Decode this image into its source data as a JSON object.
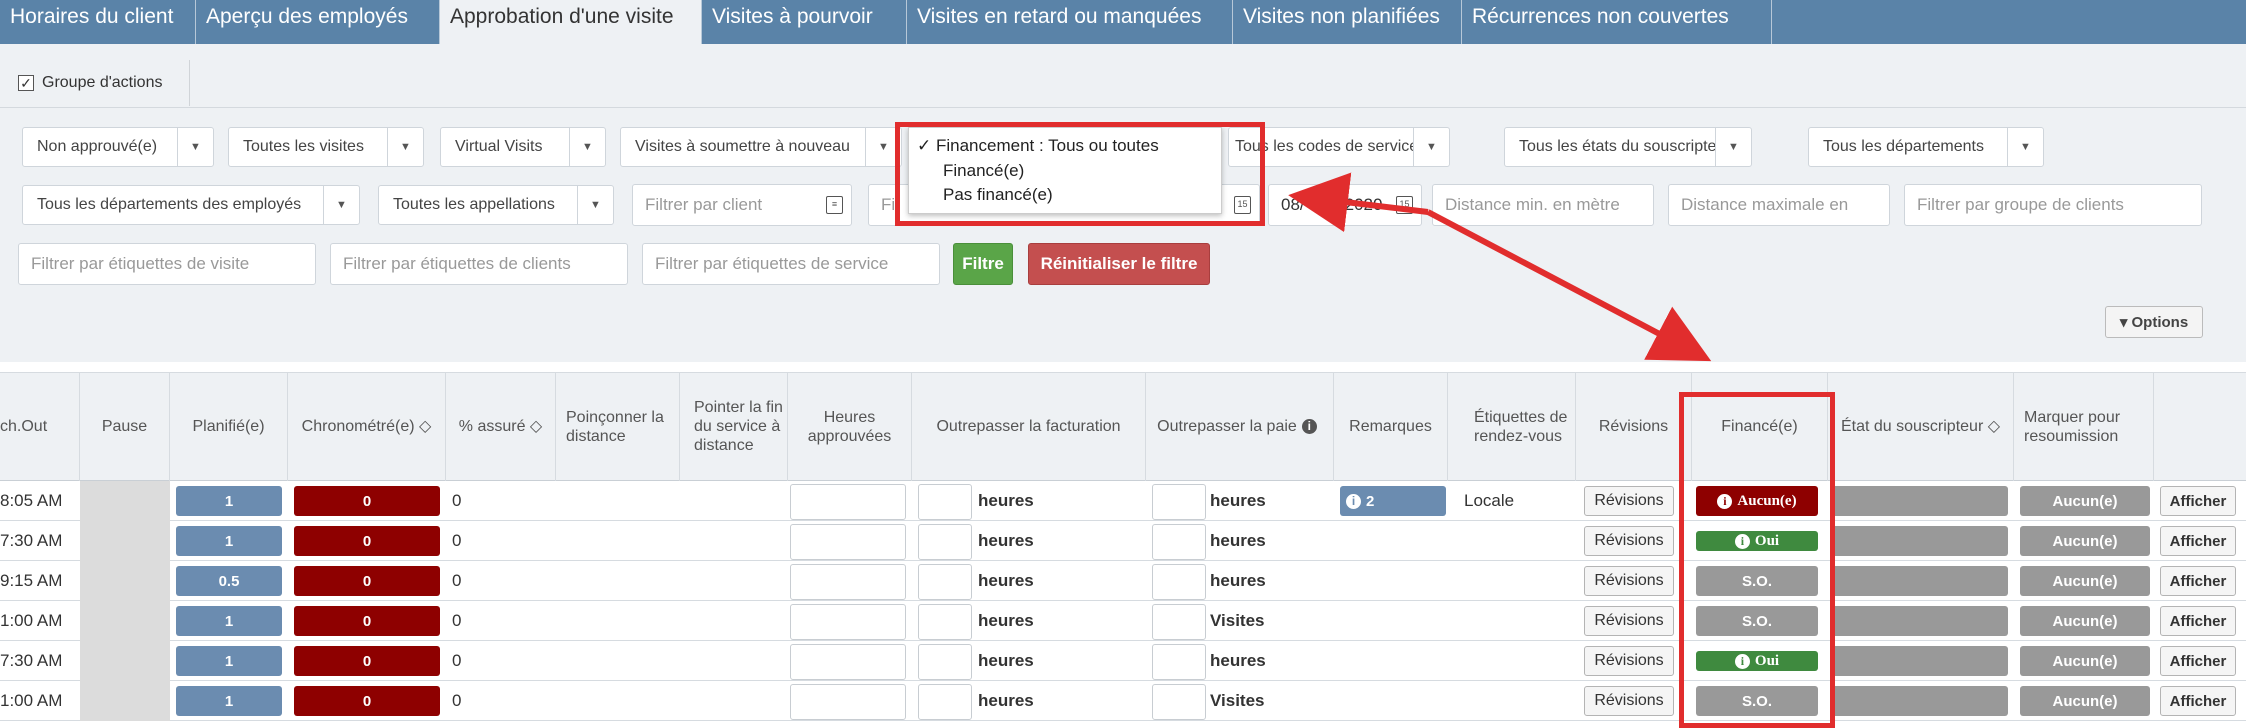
{
  "tabs": [
    {
      "label": "Horaires du client"
    },
    {
      "label": "Aperçu des employés"
    },
    {
      "label": "Approbation d'une visite"
    },
    {
      "label": "Visites à pourvoir"
    },
    {
      "label": "Visites en retard ou manquées"
    },
    {
      "label": "Visites non planifiées"
    },
    {
      "label": "Récurrences non couvertes"
    }
  ],
  "toolbar": {
    "group_actions": "Groupe d'actions"
  },
  "filters": {
    "row1": [
      {
        "label": "Non approuvé(e)"
      },
      {
        "label": "Toutes les visites"
      },
      {
        "label": "Virtual Visits"
      },
      {
        "label": "Visites à soumettre à nouveau"
      },
      {
        "label": "Financement : Tous ou toutes"
      },
      {
        "label": "Tous les codes de service"
      },
      {
        "label": "Tous les états du souscripteur"
      },
      {
        "label": "Tous les départements"
      }
    ],
    "row2": [
      {
        "label": "Tous les départements des employés"
      },
      {
        "label": "Toutes les appellations"
      }
    ],
    "client_placeholder": "Filtrer par client",
    "date_from_fragment": "Fi",
    "date_to_fragment_start": "08/",
    "date_to_fragment_end": "2020",
    "min_distance_placeholder": "Distance min. en mètre",
    "max_distance_placeholder": "Distance maximale en",
    "client_group_placeholder": "Filtrer par groupe de clients",
    "visit_tags_placeholder": "Filtrer par étiquettes de visite",
    "client_tags_placeholder": "Filtrer par étiquettes de clients",
    "service_tags_placeholder": "Filtrer par étiquettes de service",
    "filter_button": "Filtre",
    "reset_button": "Réinitialiser le filtre",
    "options_button": "▾ Options"
  },
  "funding_menu": {
    "check": "✓",
    "items": [
      "Financement : Tous ou toutes",
      "Financé(e)",
      "Pas financé(e)"
    ]
  },
  "table": {
    "headers": {
      "punch_out": "ch.Out",
      "pause": "Pause",
      "scheduled": "Planifié(e)",
      "timed": "Chronométré(e) ◇",
      "pct_insured": "% assuré ◇",
      "punch_distance": "Poinçonner la distance",
      "point_end": "Pointer la fin du service à distance",
      "approved_hours": "Heures approuvées",
      "override_billing": "Outrepasser la facturation",
      "override_pay": "Outrepasser la paie",
      "remarks": "Remarques",
      "appt_tags": "Étiquettes de rendez-vous",
      "revisions": "Révisions",
      "funded": "Financé(e)",
      "payer_state": "État du souscripteur ◇",
      "mark_resubmit": "Marquer pour resoumission"
    },
    "rows": [
      {
        "time": "8:05 AM",
        "scheduled": "1",
        "timed": "0",
        "pct": "0",
        "billing_unit": "heures",
        "pay_unit": "heures",
        "remark": "2",
        "tag": "Locale",
        "revisions": "Révisions",
        "funded": "Aucun(e)",
        "funded_style": "red",
        "mark": "Aucun(e)",
        "view": "Afficher"
      },
      {
        "time": "7:30 AM",
        "scheduled": "1",
        "timed": "0",
        "pct": "0",
        "billing_unit": "heures",
        "pay_unit": "heures",
        "remark": "",
        "tag": "",
        "revisions": "Révisions",
        "funded": "Oui",
        "funded_style": "green",
        "mark": "Aucun(e)",
        "view": "Afficher"
      },
      {
        "time": "9:15 AM",
        "scheduled": "0.5",
        "timed": "0",
        "pct": "0",
        "billing_unit": "heures",
        "pay_unit": "heures",
        "remark": "",
        "tag": "",
        "revisions": "Révisions",
        "funded": "S.O.",
        "funded_style": "grey",
        "mark": "Aucun(e)",
        "view": "Afficher"
      },
      {
        "time": "1:00 AM",
        "scheduled": "1",
        "timed": "0",
        "pct": "0",
        "billing_unit": "heures",
        "pay_unit": "Visites",
        "remark": "",
        "tag": "",
        "revisions": "Révisions",
        "funded": "S.O.",
        "funded_style": "grey",
        "mark": "Aucun(e)",
        "view": "Afficher"
      },
      {
        "time": "7:30 AM",
        "scheduled": "1",
        "timed": "0",
        "pct": "0",
        "billing_unit": "heures",
        "pay_unit": "heures",
        "remark": "",
        "tag": "",
        "revisions": "Révisions",
        "funded": "Oui",
        "funded_style": "green",
        "mark": "Aucun(e)",
        "view": "Afficher"
      },
      {
        "time": "1:00 AM",
        "scheduled": "1",
        "timed": "0",
        "pct": "0",
        "billing_unit": "heures",
        "pay_unit": "Visites",
        "remark": "",
        "tag": "",
        "revisions": "Révisions",
        "funded": "S.O.",
        "funded_style": "grey",
        "mark": "Aucun(e)",
        "view": "Afficher"
      }
    ]
  },
  "colors": {
    "annotation": "#e12d2d",
    "tab_bar": "#5a83a8",
    "funded_red": "#8e0000",
    "funded_green": "#3f8a3f"
  }
}
